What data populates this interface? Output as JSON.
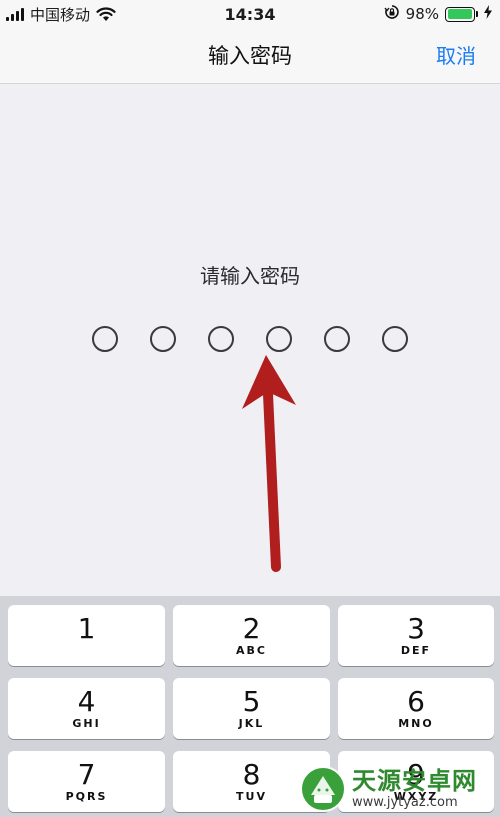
{
  "status_bar": {
    "carrier": "中国移动",
    "time": "14:34",
    "battery_percent": "98%",
    "battery_level": 0.98,
    "icons": [
      "signal-icon",
      "wifi-icon",
      "orientation-lock-icon",
      "battery-icon",
      "charging-icon"
    ]
  },
  "nav": {
    "title": "输入密码",
    "cancel_label": "取消"
  },
  "content": {
    "prompt": "请输入密码",
    "passcode_length": 6,
    "entered": 0
  },
  "keypad": {
    "keys": [
      {
        "digit": "1",
        "letters": ""
      },
      {
        "digit": "2",
        "letters": "ABC"
      },
      {
        "digit": "3",
        "letters": "DEF"
      },
      {
        "digit": "4",
        "letters": "GHI"
      },
      {
        "digit": "5",
        "letters": "JKL"
      },
      {
        "digit": "6",
        "letters": "MNO"
      },
      {
        "digit": "7",
        "letters": "PQRS"
      },
      {
        "digit": "8",
        "letters": "TUV"
      },
      {
        "digit": "9",
        "letters": "WXYZ"
      }
    ]
  },
  "watermark": {
    "name": "天源安卓网",
    "url": "www.jytyaz.com"
  },
  "colors": {
    "accent": "#1a7cf2",
    "arrow": "#b01e1e",
    "battery": "#34c759",
    "background": "#efeff4",
    "keypad_bg": "#d1d3d9"
  }
}
